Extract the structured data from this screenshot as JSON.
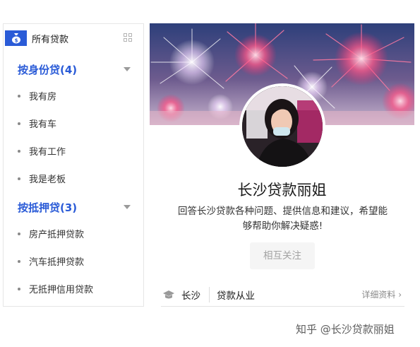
{
  "sidebar": {
    "title": "所有贷款",
    "groups": [
      {
        "label": "按身份贷(4)",
        "items": [
          "我有房",
          "我有车",
          "我有工作",
          "我是老板"
        ]
      },
      {
        "label": "按抵押贷(3)",
        "items": [
          "房产抵押贷款",
          "汽车抵押贷款",
          "无抵押信用贷款"
        ]
      }
    ]
  },
  "profile": {
    "name": "长沙贷款丽姐",
    "bio_line1": "回答长沙贷款各种问题、提供信息和建议，希望能",
    "bio_line2": "够帮助你解决疑惑!",
    "follow_label": "相互关注",
    "city": "长沙",
    "occupation": "贷款从业",
    "detail_label": "详细资料 ›"
  },
  "watermark": "知乎 @长沙贷款丽姐",
  "colors": {
    "accent": "#2a5bd7",
    "follow_bg": "#f5f5f5"
  }
}
